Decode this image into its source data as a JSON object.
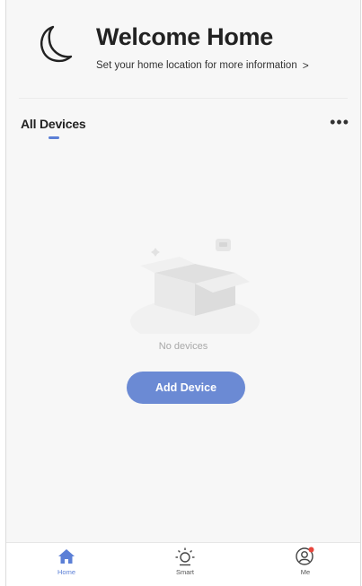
{
  "header": {
    "title": "Welcome Home",
    "location_link": "Set your home location for more information",
    "chevron": ">"
  },
  "tabs": {
    "all_devices": "All Devices",
    "more": "•••"
  },
  "empty_state": {
    "message": "No devices",
    "button_label": "Add Device"
  },
  "bottom_nav": {
    "items": [
      {
        "label": "Home",
        "icon": "home-icon",
        "active": true
      },
      {
        "label": "Smart",
        "icon": "sun-icon",
        "active": false
      },
      {
        "label": "Me",
        "icon": "user-icon",
        "active": false,
        "badge": true
      }
    ]
  },
  "colors": {
    "accent": "#5b7fd6",
    "button": "#6b8ad4",
    "badge": "#e8453c",
    "background": "#f7f7f7"
  }
}
